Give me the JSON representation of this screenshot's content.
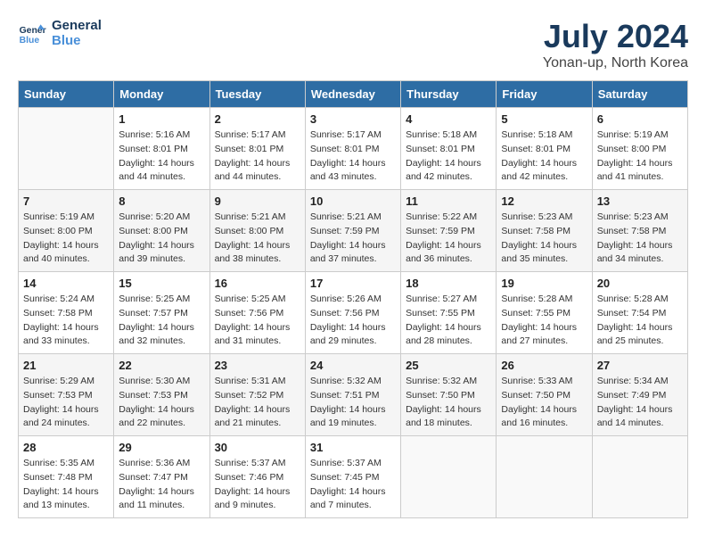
{
  "header": {
    "logo_line1": "General",
    "logo_line2": "Blue",
    "month": "July 2024",
    "location": "Yonan-up, North Korea"
  },
  "weekdays": [
    "Sunday",
    "Monday",
    "Tuesday",
    "Wednesday",
    "Thursday",
    "Friday",
    "Saturday"
  ],
  "weeks": [
    [
      {
        "day": "",
        "sunrise": "",
        "sunset": "",
        "daylight": ""
      },
      {
        "day": "1",
        "sunrise": "5:16 AM",
        "sunset": "8:01 PM",
        "daylight": "14 hours and 44 minutes."
      },
      {
        "day": "2",
        "sunrise": "5:17 AM",
        "sunset": "8:01 PM",
        "daylight": "14 hours and 44 minutes."
      },
      {
        "day": "3",
        "sunrise": "5:17 AM",
        "sunset": "8:01 PM",
        "daylight": "14 hours and 43 minutes."
      },
      {
        "day": "4",
        "sunrise": "5:18 AM",
        "sunset": "8:01 PM",
        "daylight": "14 hours and 42 minutes."
      },
      {
        "day": "5",
        "sunrise": "5:18 AM",
        "sunset": "8:01 PM",
        "daylight": "14 hours and 42 minutes."
      },
      {
        "day": "6",
        "sunrise": "5:19 AM",
        "sunset": "8:00 PM",
        "daylight": "14 hours and 41 minutes."
      }
    ],
    [
      {
        "day": "7",
        "sunrise": "5:19 AM",
        "sunset": "8:00 PM",
        "daylight": "14 hours and 40 minutes."
      },
      {
        "day": "8",
        "sunrise": "5:20 AM",
        "sunset": "8:00 PM",
        "daylight": "14 hours and 39 minutes."
      },
      {
        "day": "9",
        "sunrise": "5:21 AM",
        "sunset": "8:00 PM",
        "daylight": "14 hours and 38 minutes."
      },
      {
        "day": "10",
        "sunrise": "5:21 AM",
        "sunset": "7:59 PM",
        "daylight": "14 hours and 37 minutes."
      },
      {
        "day": "11",
        "sunrise": "5:22 AM",
        "sunset": "7:59 PM",
        "daylight": "14 hours and 36 minutes."
      },
      {
        "day": "12",
        "sunrise": "5:23 AM",
        "sunset": "7:58 PM",
        "daylight": "14 hours and 35 minutes."
      },
      {
        "day": "13",
        "sunrise": "5:23 AM",
        "sunset": "7:58 PM",
        "daylight": "14 hours and 34 minutes."
      }
    ],
    [
      {
        "day": "14",
        "sunrise": "5:24 AM",
        "sunset": "7:58 PM",
        "daylight": "14 hours and 33 minutes."
      },
      {
        "day": "15",
        "sunrise": "5:25 AM",
        "sunset": "7:57 PM",
        "daylight": "14 hours and 32 minutes."
      },
      {
        "day": "16",
        "sunrise": "5:25 AM",
        "sunset": "7:56 PM",
        "daylight": "14 hours and 31 minutes."
      },
      {
        "day": "17",
        "sunrise": "5:26 AM",
        "sunset": "7:56 PM",
        "daylight": "14 hours and 29 minutes."
      },
      {
        "day": "18",
        "sunrise": "5:27 AM",
        "sunset": "7:55 PM",
        "daylight": "14 hours and 28 minutes."
      },
      {
        "day": "19",
        "sunrise": "5:28 AM",
        "sunset": "7:55 PM",
        "daylight": "14 hours and 27 minutes."
      },
      {
        "day": "20",
        "sunrise": "5:28 AM",
        "sunset": "7:54 PM",
        "daylight": "14 hours and 25 minutes."
      }
    ],
    [
      {
        "day": "21",
        "sunrise": "5:29 AM",
        "sunset": "7:53 PM",
        "daylight": "14 hours and 24 minutes."
      },
      {
        "day": "22",
        "sunrise": "5:30 AM",
        "sunset": "7:53 PM",
        "daylight": "14 hours and 22 minutes."
      },
      {
        "day": "23",
        "sunrise": "5:31 AM",
        "sunset": "7:52 PM",
        "daylight": "14 hours and 21 minutes."
      },
      {
        "day": "24",
        "sunrise": "5:32 AM",
        "sunset": "7:51 PM",
        "daylight": "14 hours and 19 minutes."
      },
      {
        "day": "25",
        "sunrise": "5:32 AM",
        "sunset": "7:50 PM",
        "daylight": "14 hours and 18 minutes."
      },
      {
        "day": "26",
        "sunrise": "5:33 AM",
        "sunset": "7:50 PM",
        "daylight": "14 hours and 16 minutes."
      },
      {
        "day": "27",
        "sunrise": "5:34 AM",
        "sunset": "7:49 PM",
        "daylight": "14 hours and 14 minutes."
      }
    ],
    [
      {
        "day": "28",
        "sunrise": "5:35 AM",
        "sunset": "7:48 PM",
        "daylight": "14 hours and 13 minutes."
      },
      {
        "day": "29",
        "sunrise": "5:36 AM",
        "sunset": "7:47 PM",
        "daylight": "14 hours and 11 minutes."
      },
      {
        "day": "30",
        "sunrise": "5:37 AM",
        "sunset": "7:46 PM",
        "daylight": "14 hours and 9 minutes."
      },
      {
        "day": "31",
        "sunrise": "5:37 AM",
        "sunset": "7:45 PM",
        "daylight": "14 hours and 7 minutes."
      },
      {
        "day": "",
        "sunrise": "",
        "sunset": "",
        "daylight": ""
      },
      {
        "day": "",
        "sunrise": "",
        "sunset": "",
        "daylight": ""
      },
      {
        "day": "",
        "sunrise": "",
        "sunset": "",
        "daylight": ""
      }
    ]
  ],
  "labels": {
    "sunrise_prefix": "Sunrise: ",
    "sunset_prefix": "Sunset: ",
    "daylight_prefix": "Daylight: "
  }
}
